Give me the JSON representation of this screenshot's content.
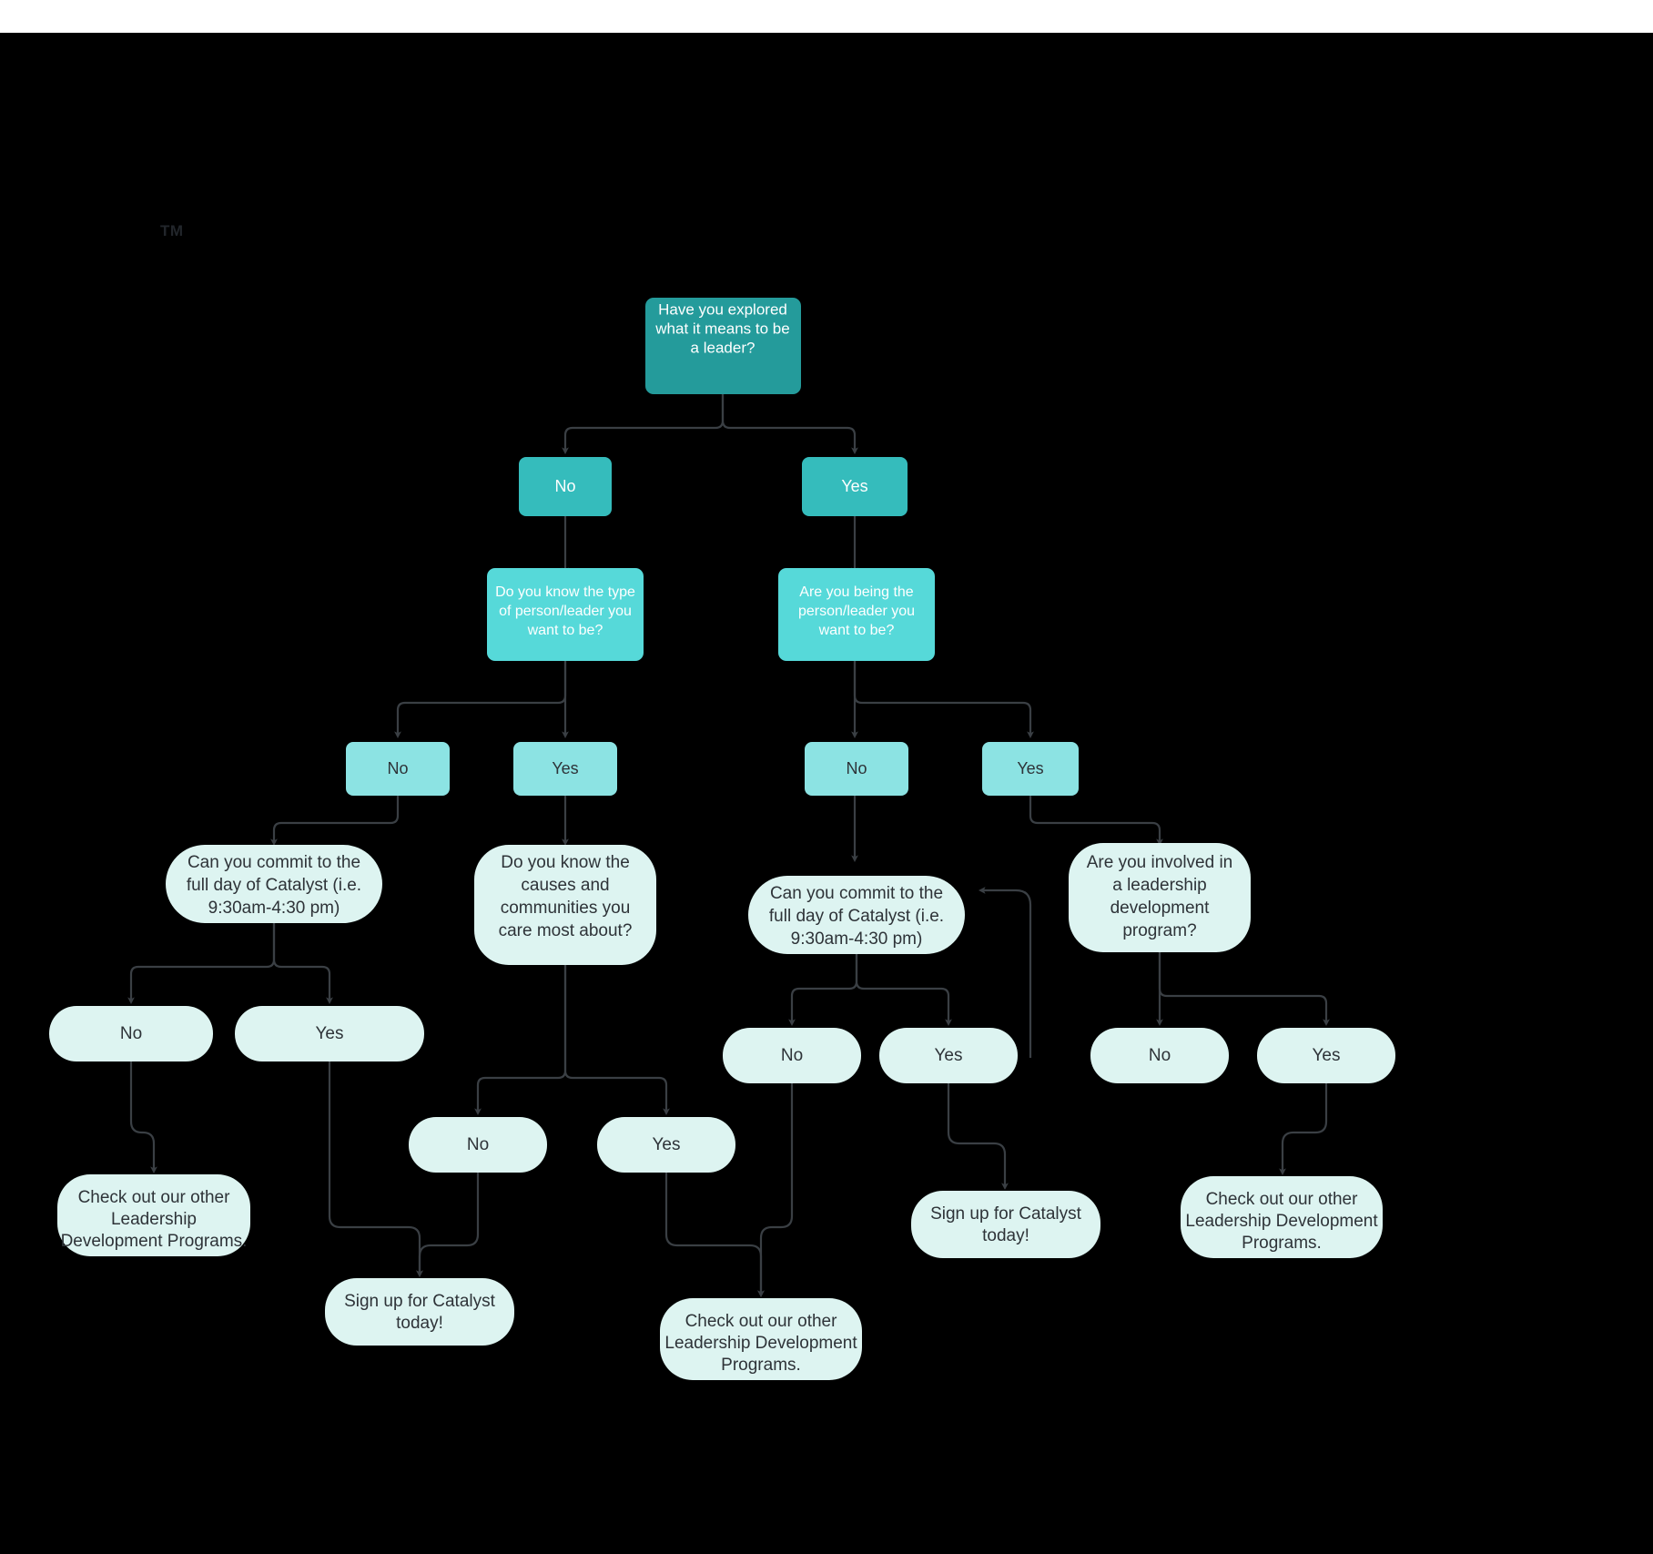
{
  "page": {
    "background": "#000000",
    "topbar_background": "#ffffff",
    "logo_tm": "TM"
  },
  "palette": {
    "root_fill": "#249b9b",
    "level2_fill": "#35bcbc",
    "level3_fill": "#56d9d9",
    "level4_fill": "#8ce3e3",
    "pill_fill": "#ddf4f1",
    "edge_color": "#3a3f44",
    "text_light": "#ffffff",
    "text_dark": "#2e3338"
  },
  "nodes": {
    "root": {
      "label": "Have you explored what it means to be a leader?"
    },
    "root_no": {
      "label": "No"
    },
    "root_yes": {
      "label": "Yes"
    },
    "q_type": {
      "label": "Do you know the type of person/leader you want to be?"
    },
    "q_being": {
      "label": "Are you being the person/leader you want to be?"
    },
    "q_type_no": {
      "label": "No"
    },
    "q_type_yes": {
      "label": "Yes"
    },
    "q_being_no": {
      "label": "No"
    },
    "q_being_yes": {
      "label": "Yes"
    },
    "commit_left": {
      "label": "Can you commit to the full day of Catalyst  (i.e. 9:30am-4:30 pm)"
    },
    "causes": {
      "label": "Do you know the causes and communities you care most about?"
    },
    "commit_right": {
      "label": "Can you commit to the full day of Catalyst  (i.e. 9:30am-4:30 pm)"
    },
    "leadership_prog": {
      "label": "Are you involved in a leadership development program?"
    },
    "commit_left_no": {
      "label": "No"
    },
    "commit_left_yes": {
      "label": "Yes"
    },
    "causes_no": {
      "label": "No"
    },
    "causes_yes": {
      "label": "Yes"
    },
    "commit_right_no": {
      "label": "No"
    },
    "commit_right_yes": {
      "label": "Yes"
    },
    "prog_no": {
      "label": "No"
    },
    "prog_yes": {
      "label": "Yes"
    },
    "leaf_other_1": {
      "label": "Check out our other Leadership Development Programs."
    },
    "leaf_signup_1": {
      "label": "Sign up for Catalyst today!"
    },
    "leaf_other_2": {
      "label": "Check out our other Leadership Development Programs."
    },
    "leaf_signup_2": {
      "label": "Sign up for Catalyst today!"
    },
    "leaf_other_3": {
      "label": "Check out our other Leadership Development Programs."
    }
  },
  "node_lines": {
    "root": [
      "Have you explored",
      "what it means to be",
      "a leader?"
    ],
    "q_type": [
      "Do you know the type",
      "of person/leader you",
      "want to be?"
    ],
    "q_being": [
      "Are you being the",
      "person/leader you",
      "want to be?"
    ],
    "commit_left": [
      "Can you commit to the",
      "full day of Catalyst  (i.e.",
      "9:30am-4:30 pm)"
    ],
    "causes": [
      "Do you know the",
      "causes and",
      "communities you",
      "care most about?"
    ],
    "commit_right": [
      "Can you commit to the",
      "full day of Catalyst  (i.e.",
      "9:30am-4:30 pm)"
    ],
    "leadership_prog": [
      "Are you involved in",
      "a leadership",
      "development",
      "program?"
    ],
    "leaf_other_1": [
      "Check out our other",
      "Leadership",
      "Development Programs."
    ],
    "leaf_signup_1": [
      "Sign up for Catalyst",
      "today!"
    ],
    "leaf_other_2": [
      "Check out our other",
      "Leadership Development",
      "Programs."
    ],
    "leaf_signup_2": [
      "Sign up for Catalyst",
      "today!"
    ],
    "leaf_other_3": [
      "Check out our other",
      "Leadership Development",
      "Programs."
    ]
  }
}
